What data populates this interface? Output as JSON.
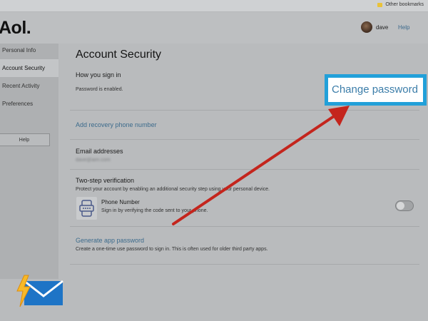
{
  "bookmarks": {
    "other_label": "Other bookmarks"
  },
  "header": {
    "logo": "Aol.",
    "username": "dave",
    "help": "Help"
  },
  "sidebar": {
    "items": [
      {
        "label": "Personal Info"
      },
      {
        "label": "Account Security"
      },
      {
        "label": "Recent Activity"
      },
      {
        "label": "Preferences"
      }
    ],
    "help_button": "Help"
  },
  "main": {
    "title": "Account Security",
    "sign_in": {
      "heading": "How you sign in",
      "status": "Password is enabled.",
      "change_password": "Change password"
    },
    "recovery": {
      "link": "Add recovery phone number"
    },
    "email": {
      "heading": "Email addresses",
      "address": "dave@aim.com"
    },
    "two_step": {
      "heading": "Two-step verification",
      "description": "Protect your account by enabling an additional security step using your personal device.",
      "method_title": "Phone Number",
      "method_desc": "Sign in by verifying the code sent to your phone."
    },
    "app_password": {
      "link": "Generate app password",
      "description": "Create a one-time use password to sign in. This is often used for older third party apps."
    }
  },
  "colors": {
    "highlight_border": "#22a0d9",
    "arrow": "#c4251d",
    "link": "#3c6b8c"
  }
}
